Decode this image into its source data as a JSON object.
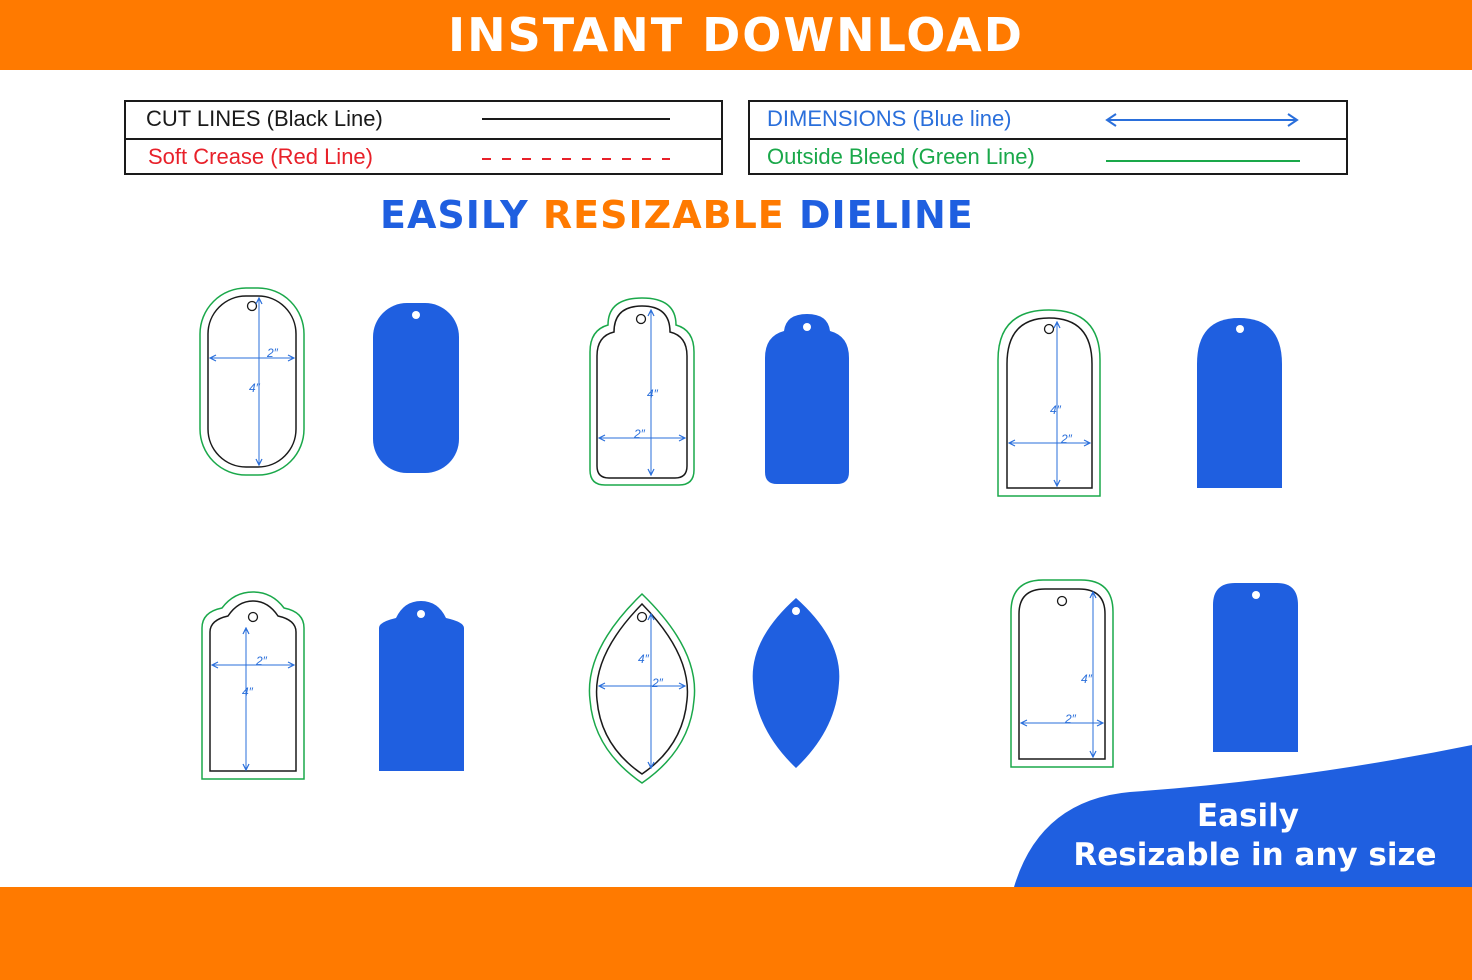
{
  "header": {
    "title": "INSTANT DOWNLOAD"
  },
  "legend": {
    "cut_lines": "CUT LINES (Black Line)",
    "soft_crease": "Soft Crease (Red Line)",
    "dimensions": "DIMENSIONS (Blue line)",
    "outside_bleed": "Outside Bleed (Green Line)"
  },
  "subtitle": {
    "part1": "EASILY",
    "part2": "RESIZABLE",
    "part3": "DIELINE"
  },
  "dim_labels": {
    "width": "2″",
    "height": "4″"
  },
  "corner": {
    "line1": "Easily",
    "line2": "Resizable in any size"
  },
  "colors": {
    "orange": "#ff7a00",
    "blue": "#1f5fe0",
    "dimension_blue": "#2a6fdb",
    "cut_black": "#1a1a1a",
    "crease_red": "#e8212a",
    "bleed_green": "#1aa84a"
  }
}
